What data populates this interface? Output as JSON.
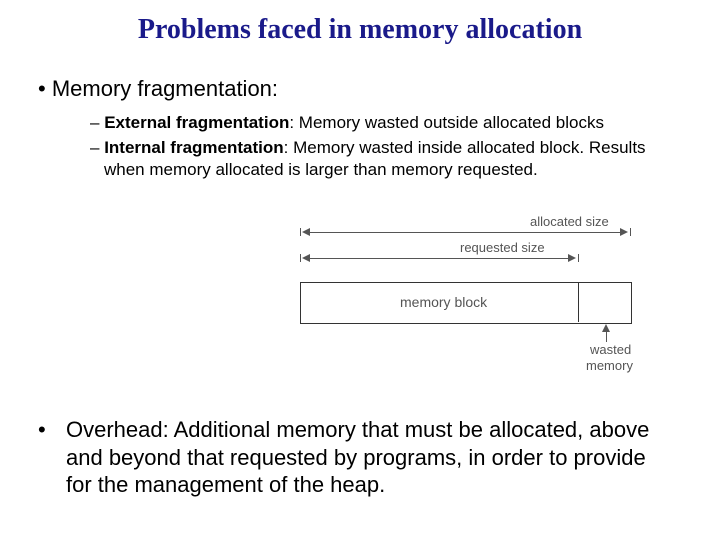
{
  "title": "Problems faced in memory allocation",
  "bullets": {
    "frag_heading": "Memory fragmentation:",
    "external": {
      "lead": "External fragmentation",
      "rest": ": Memory wasted outside allocated blocks"
    },
    "internal": {
      "lead": "Internal fragmentation",
      "rest": ": Memory wasted inside allocated block. Results when memory allocated is larger than memory requested."
    },
    "overhead": "Overhead: Additional memory that must be allocated, above and beyond that requested by programs, in order to provide for the management of the heap."
  },
  "diagram": {
    "allocated_label": "allocated size",
    "requested_label": "requested size",
    "block_label": "memory block",
    "wasted_label_line1": "wasted",
    "wasted_label_line2": "memory"
  }
}
